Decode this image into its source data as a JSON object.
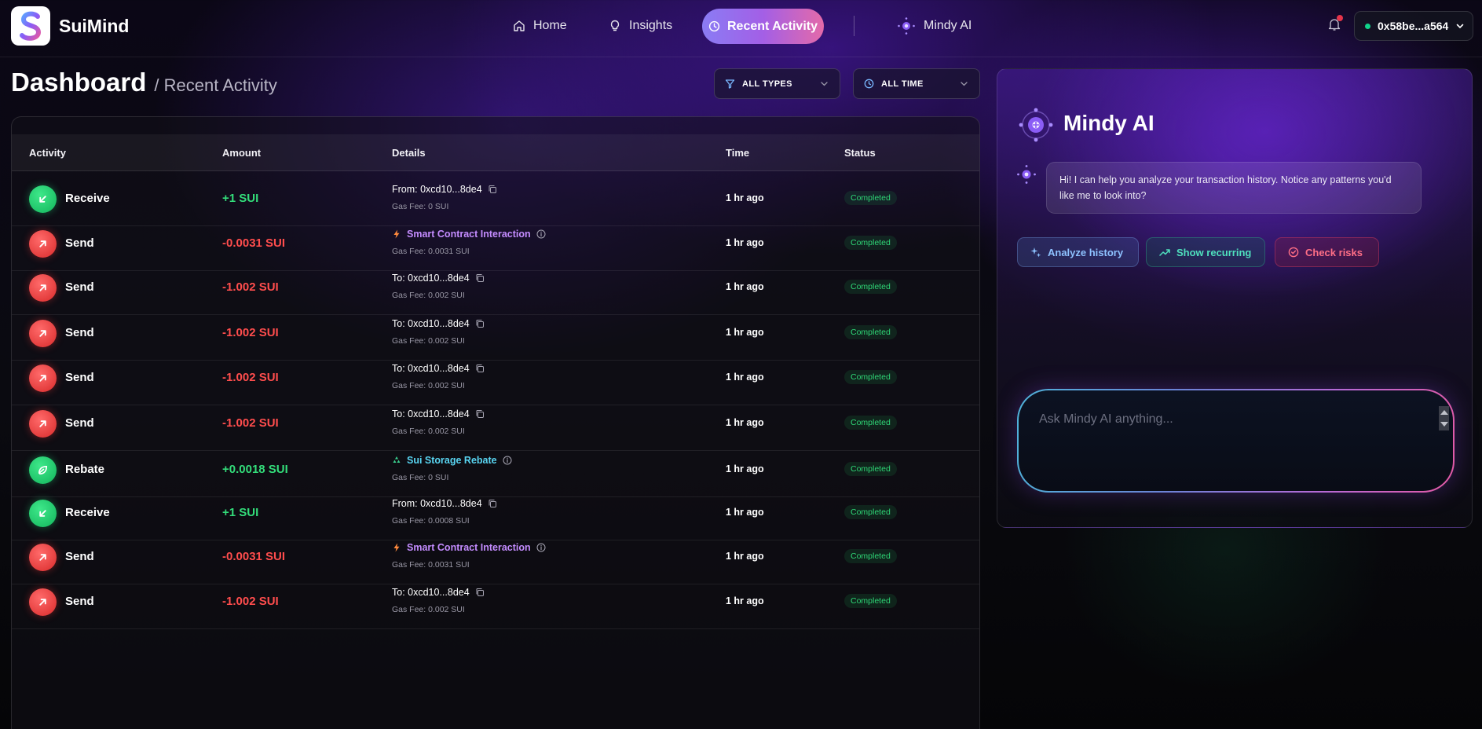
{
  "app": {
    "brand": "SuiMind"
  },
  "nav": {
    "home": "Home",
    "insights": "Insights",
    "recent_activity": "Recent Activity",
    "mindy": "Mindy AI"
  },
  "wallet": {
    "address": "0x58be...a564"
  },
  "page": {
    "title": "Dashboard",
    "breadcrumb": "/ Recent Activity"
  },
  "filters": {
    "types": "ALL TYPES",
    "time": "ALL TIME"
  },
  "table": {
    "headers": [
      "Activity",
      "Amount",
      "Details",
      "Time",
      "Status"
    ],
    "rows": [
      {
        "activity": "Receive",
        "kind": "recv",
        "amount": "+1 SUI",
        "detail": "From: 0xcd10...8de4",
        "detail_kind": "address",
        "gas": "Gas Fee: 0 SUI",
        "time": "1 hr ago",
        "status": "Completed"
      },
      {
        "activity": "Send",
        "kind": "send",
        "amount": "-0.0031 SUI",
        "detail": "Smart Contract Interaction",
        "detail_kind": "contract",
        "gas": "Gas Fee: 0.0031 SUI",
        "time": "1 hr ago",
        "status": "Completed"
      },
      {
        "activity": "Send",
        "kind": "send",
        "amount": "-1.002 SUI",
        "detail": "To: 0xcd10...8de4",
        "detail_kind": "address",
        "gas": "Gas Fee: 0.002 SUI",
        "time": "1 hr ago",
        "status": "Completed"
      },
      {
        "activity": "Send",
        "kind": "send",
        "amount": "-1.002 SUI",
        "detail": "To: 0xcd10...8de4",
        "detail_kind": "address",
        "gas": "Gas Fee: 0.002 SUI",
        "time": "1 hr ago",
        "status": "Completed"
      },
      {
        "activity": "Send",
        "kind": "send",
        "amount": "-1.002 SUI",
        "detail": "To: 0xcd10...8de4",
        "detail_kind": "address",
        "gas": "Gas Fee: 0.002 SUI",
        "time": "1 hr ago",
        "status": "Completed"
      },
      {
        "activity": "Send",
        "kind": "send",
        "amount": "-1.002 SUI",
        "detail": "To: 0xcd10...8de4",
        "detail_kind": "address",
        "gas": "Gas Fee: 0.002 SUI",
        "time": "1 hr ago",
        "status": "Completed"
      },
      {
        "activity": "Rebate",
        "kind": "rebate",
        "amount": "+0.0018 SUI",
        "detail": "Sui Storage Rebate",
        "detail_kind": "rebate",
        "gas": "Gas Fee: 0 SUI",
        "time": "1 hr ago",
        "status": "Completed"
      },
      {
        "activity": "Receive",
        "kind": "recv",
        "amount": "+1 SUI",
        "detail": "From: 0xcd10...8de4",
        "detail_kind": "address",
        "gas": "Gas Fee: 0.0008 SUI",
        "time": "1 hr ago",
        "status": "Completed"
      },
      {
        "activity": "Send",
        "kind": "send",
        "amount": "-0.0031 SUI",
        "detail": "Smart Contract Interaction",
        "detail_kind": "contract",
        "gas": "Gas Fee: 0.0031 SUI",
        "time": "1 hr ago",
        "status": "Completed"
      },
      {
        "activity": "Send",
        "kind": "send",
        "amount": "-1.002 SUI",
        "detail": "To: 0xcd10...8de4",
        "detail_kind": "address",
        "gas": "Gas Fee: 0.002 SUI",
        "time": "1 hr ago",
        "status": "Completed"
      }
    ]
  },
  "ai": {
    "title": "Mindy AI",
    "greeting": "Hi! I can help you analyze your transaction history. Notice any patterns you'd like me to look into?",
    "actions": {
      "analyze": "Analyze history",
      "recurring": "Show recurring",
      "risks": "Check risks"
    },
    "input_placeholder": "Ask Mindy AI anything..."
  },
  "colors": {
    "accent_purple": "#8a5cf6",
    "send_red": "#ff4d4d",
    "receive_green": "#33dd7a",
    "status_green": "#2fd877",
    "contract_purple": "#c48cff",
    "rebate_cyan": "#59d5f2"
  }
}
